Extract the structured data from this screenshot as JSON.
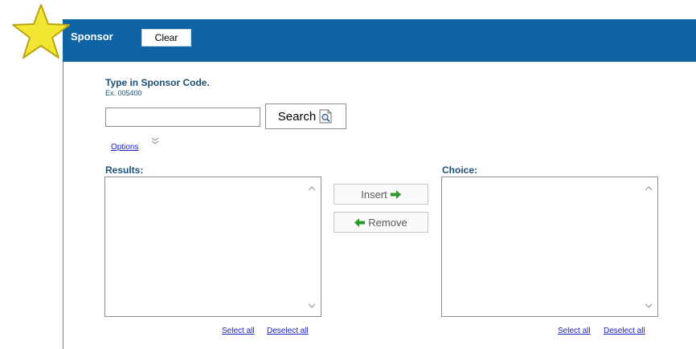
{
  "header": {
    "title": "Sponsor",
    "clear_label": "Clear",
    "color": "#0e63a5"
  },
  "prompt": {
    "title": "Type in Sponsor Code.",
    "example": "Ex. 005400"
  },
  "search": {
    "value": "",
    "button_label": "Search"
  },
  "options_label": "Options",
  "results": {
    "label": "Results:",
    "select_all": "Select all",
    "deselect_all": "Deselect all"
  },
  "choice": {
    "label": "Choice:",
    "select_all": "Select all",
    "deselect_all": "Deselect all"
  },
  "buttons": {
    "insert": "Insert",
    "remove": "Remove"
  },
  "icons": {
    "star": "star-icon",
    "search": "magnifier-icon",
    "arrows": "green-arrow-icon",
    "chevron": "double-chevron-down-icon"
  }
}
